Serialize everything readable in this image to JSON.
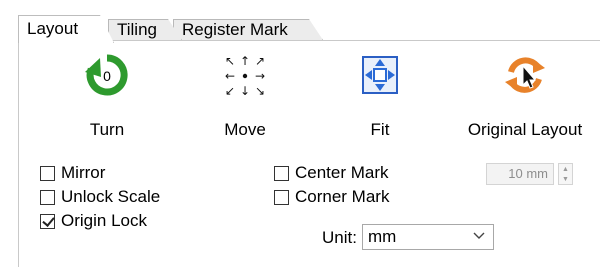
{
  "tabs": [
    {
      "label": "Layout",
      "active": true
    },
    {
      "label": "Tiling",
      "active": false
    },
    {
      "label": "Register Mark",
      "active": false
    }
  ],
  "tools": {
    "turn": {
      "label": "Turn",
      "icon": "rotate-counter-icon",
      "badge": "0",
      "color": "#2e9a2e"
    },
    "move": {
      "label": "Move",
      "icon": "move-arrows-icon"
    },
    "fit": {
      "label": "Fit",
      "icon": "fit-to-page-icon",
      "color": "#2b6bd6"
    },
    "original": {
      "label": "Original Layout",
      "icon": "reset-layout-icon",
      "color": "#e8822a"
    }
  },
  "checkboxes": {
    "mirror": {
      "label": "Mirror",
      "checked": false
    },
    "unlock_scale": {
      "label": "Unlock Scale",
      "checked": false
    },
    "origin_lock": {
      "label": "Origin Lock",
      "checked": true
    },
    "center_mark": {
      "label": "Center Mark",
      "checked": false
    },
    "corner_mark": {
      "label": "Corner Mark",
      "checked": false
    }
  },
  "spinner": {
    "value": "10 mm",
    "disabled": true
  },
  "unit": {
    "label": "Unit:",
    "selected": "mm"
  }
}
